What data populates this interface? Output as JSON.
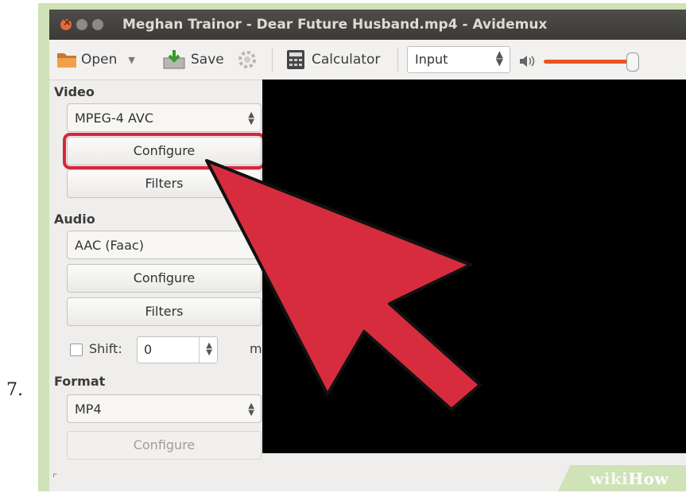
{
  "step": {
    "number": "7."
  },
  "window": {
    "title": "Meghan Trainor - Dear Future Husband.mp4 - Avidemux"
  },
  "toolbar": {
    "open_label": "Open",
    "save_label": "Save",
    "calculator_label": "Calculator",
    "mode_value": "Input",
    "volume_level": 1.0
  },
  "video_section": {
    "heading": "Video",
    "codec_value": "MPEG-4 AVC",
    "configure_label": "Configure",
    "filters_label": "Filters"
  },
  "audio_section": {
    "heading": "Audio",
    "codec_value": "AAC (Faac)",
    "configure_label": "Configure",
    "filters_label": "Filters",
    "shift_label": "Shift:",
    "shift_value": "0",
    "shift_unit": "ms"
  },
  "format_section": {
    "heading": "Format",
    "container_value": "MP4",
    "configure_label": "Configure"
  },
  "watermark": {
    "part1": "wiki",
    "part2": "How"
  },
  "colors": {
    "highlight": "#d6263c",
    "accent": "#e95420",
    "video_bg": "#000000"
  },
  "icons": [
    "close-icon",
    "minimize-icon",
    "maximize-icon",
    "open-folder-icon",
    "save-icon",
    "gear-icon",
    "calculator-icon",
    "volume-icon",
    "pointer-arrow-icon"
  ]
}
